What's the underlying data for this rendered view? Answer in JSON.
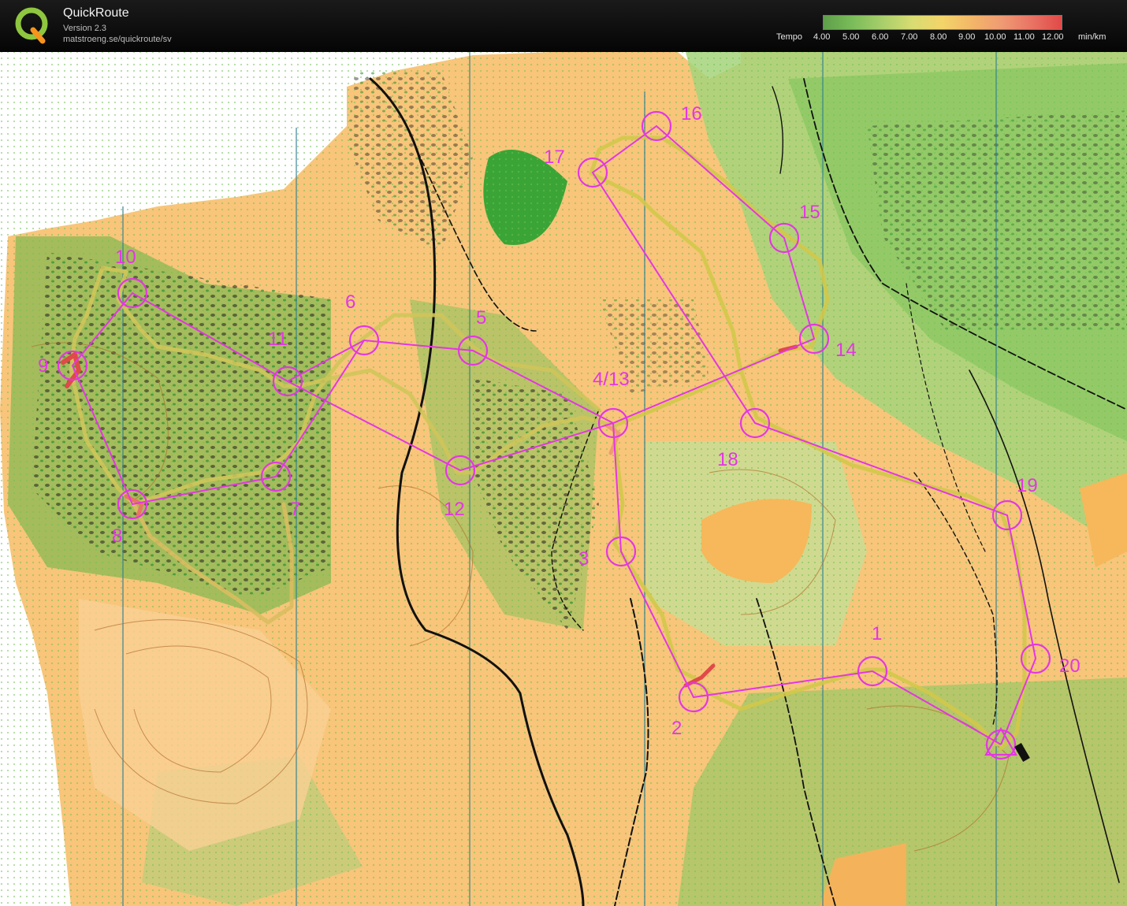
{
  "header": {
    "title": "QuickRoute",
    "version": "Version 2.3",
    "url": "matstroeng.se/quickroute/sv"
  },
  "legend": {
    "label": "Tempo",
    "ticks": [
      "4.00",
      "5.00",
      "6.00",
      "7.00",
      "8.00",
      "9.00",
      "10.00",
      "11.00",
      "12.00"
    ],
    "unit": "min/km",
    "colors": [
      "#5f9e4a",
      "#7bbd5a",
      "#a9cf6b",
      "#d9dc72",
      "#f3d46a",
      "#f3b668",
      "#ef9a74",
      "#e97364",
      "#e04a48"
    ]
  },
  "colors": {
    "course": "#e436e4",
    "terrain_open": "#f8c57a",
    "terrain_forest": "#ffffff",
    "vegetation": "#6ec24f",
    "vegetation_dark": "#3aa536",
    "route": "#d2c84a"
  },
  "controls": [
    "1",
    "2",
    "3",
    "4/13",
    "5",
    "6",
    "7",
    "8",
    "9",
    "10",
    "11",
    "12",
    "14",
    "15",
    "16",
    "17",
    "18",
    "19",
    "20"
  ]
}
